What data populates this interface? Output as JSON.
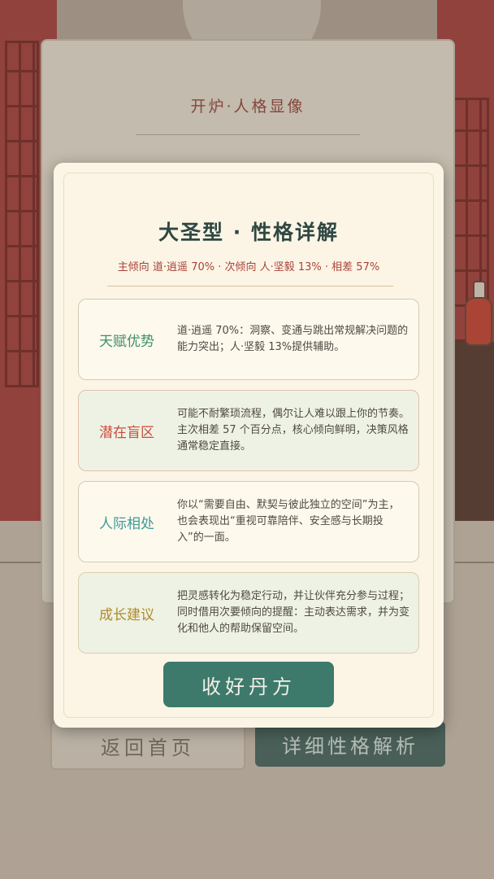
{
  "background": {
    "card_subtitle": "开炉·人格显像",
    "card_type": "大圣型",
    "home_button": "返回首页",
    "detail_button": "详细性格解析"
  },
  "modal": {
    "title": "大圣型 · 性格详解",
    "meta": "主倾向 道·逍遥 70% · 次倾向 人·坚毅 13% · 相差 57%",
    "sections": [
      {
        "label": "天赋优势",
        "text": "道·逍遥 70%：洞察、变通与跳出常规解决问题的能力突出；人·坚毅 13%提供辅助。",
        "color": "#3f8f6b"
      },
      {
        "label": "潜在盲区",
        "text": "可能不耐繁琐流程，偶尔让人难以跟上你的节奏。主次相差 57 个百分点，核心倾向鲜明，决策风格通常稳定直接。",
        "color": "#cc4b3b"
      },
      {
        "label": "人际相处",
        "text": "你以“需要自由、默契与彼此独立的空间”为主，也会表现出“重视可靠陪伴、安全感与长期投入”的一面。",
        "color": "#3f9a98"
      },
      {
        "label": "成长建议",
        "text": "把灵感转化为稳定行动，并让伙伴充分参与过程；同时借用次要倾向的提醒：主动表达需求，并为变化和他人的帮助保留空间。",
        "color": "#b08a2a"
      }
    ],
    "confirm_button": "收好丹方"
  }
}
